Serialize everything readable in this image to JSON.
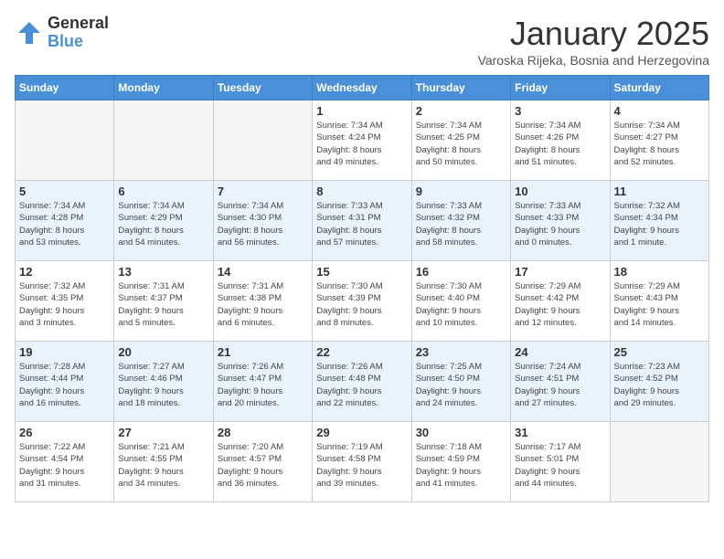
{
  "logo": {
    "general": "General",
    "blue": "Blue"
  },
  "header": {
    "month": "January 2025",
    "location": "Varoska Rijeka, Bosnia and Herzegovina"
  },
  "weekdays": [
    "Sunday",
    "Monday",
    "Tuesday",
    "Wednesday",
    "Thursday",
    "Friday",
    "Saturday"
  ],
  "weeks": [
    [
      {
        "day": "",
        "info": ""
      },
      {
        "day": "",
        "info": ""
      },
      {
        "day": "",
        "info": ""
      },
      {
        "day": "1",
        "info": "Sunrise: 7:34 AM\nSunset: 4:24 PM\nDaylight: 8 hours\nand 49 minutes."
      },
      {
        "day": "2",
        "info": "Sunrise: 7:34 AM\nSunset: 4:25 PM\nDaylight: 8 hours\nand 50 minutes."
      },
      {
        "day": "3",
        "info": "Sunrise: 7:34 AM\nSunset: 4:26 PM\nDaylight: 8 hours\nand 51 minutes."
      },
      {
        "day": "4",
        "info": "Sunrise: 7:34 AM\nSunset: 4:27 PM\nDaylight: 8 hours\nand 52 minutes."
      }
    ],
    [
      {
        "day": "5",
        "info": "Sunrise: 7:34 AM\nSunset: 4:28 PM\nDaylight: 8 hours\nand 53 minutes."
      },
      {
        "day": "6",
        "info": "Sunrise: 7:34 AM\nSunset: 4:29 PM\nDaylight: 8 hours\nand 54 minutes."
      },
      {
        "day": "7",
        "info": "Sunrise: 7:34 AM\nSunset: 4:30 PM\nDaylight: 8 hours\nand 56 minutes."
      },
      {
        "day": "8",
        "info": "Sunrise: 7:33 AM\nSunset: 4:31 PM\nDaylight: 8 hours\nand 57 minutes."
      },
      {
        "day": "9",
        "info": "Sunrise: 7:33 AM\nSunset: 4:32 PM\nDaylight: 8 hours\nand 58 minutes."
      },
      {
        "day": "10",
        "info": "Sunrise: 7:33 AM\nSunset: 4:33 PM\nDaylight: 9 hours\nand 0 minutes."
      },
      {
        "day": "11",
        "info": "Sunrise: 7:32 AM\nSunset: 4:34 PM\nDaylight: 9 hours\nand 1 minute."
      }
    ],
    [
      {
        "day": "12",
        "info": "Sunrise: 7:32 AM\nSunset: 4:35 PM\nDaylight: 9 hours\nand 3 minutes."
      },
      {
        "day": "13",
        "info": "Sunrise: 7:31 AM\nSunset: 4:37 PM\nDaylight: 9 hours\nand 5 minutes."
      },
      {
        "day": "14",
        "info": "Sunrise: 7:31 AM\nSunset: 4:38 PM\nDaylight: 9 hours\nand 6 minutes."
      },
      {
        "day": "15",
        "info": "Sunrise: 7:30 AM\nSunset: 4:39 PM\nDaylight: 9 hours\nand 8 minutes."
      },
      {
        "day": "16",
        "info": "Sunrise: 7:30 AM\nSunset: 4:40 PM\nDaylight: 9 hours\nand 10 minutes."
      },
      {
        "day": "17",
        "info": "Sunrise: 7:29 AM\nSunset: 4:42 PM\nDaylight: 9 hours\nand 12 minutes."
      },
      {
        "day": "18",
        "info": "Sunrise: 7:29 AM\nSunset: 4:43 PM\nDaylight: 9 hours\nand 14 minutes."
      }
    ],
    [
      {
        "day": "19",
        "info": "Sunrise: 7:28 AM\nSunset: 4:44 PM\nDaylight: 9 hours\nand 16 minutes."
      },
      {
        "day": "20",
        "info": "Sunrise: 7:27 AM\nSunset: 4:46 PM\nDaylight: 9 hours\nand 18 minutes."
      },
      {
        "day": "21",
        "info": "Sunrise: 7:26 AM\nSunset: 4:47 PM\nDaylight: 9 hours\nand 20 minutes."
      },
      {
        "day": "22",
        "info": "Sunrise: 7:26 AM\nSunset: 4:48 PM\nDaylight: 9 hours\nand 22 minutes."
      },
      {
        "day": "23",
        "info": "Sunrise: 7:25 AM\nSunset: 4:50 PM\nDaylight: 9 hours\nand 24 minutes."
      },
      {
        "day": "24",
        "info": "Sunrise: 7:24 AM\nSunset: 4:51 PM\nDaylight: 9 hours\nand 27 minutes."
      },
      {
        "day": "25",
        "info": "Sunrise: 7:23 AM\nSunset: 4:52 PM\nDaylight: 9 hours\nand 29 minutes."
      }
    ],
    [
      {
        "day": "26",
        "info": "Sunrise: 7:22 AM\nSunset: 4:54 PM\nDaylight: 9 hours\nand 31 minutes."
      },
      {
        "day": "27",
        "info": "Sunrise: 7:21 AM\nSunset: 4:55 PM\nDaylight: 9 hours\nand 34 minutes."
      },
      {
        "day": "28",
        "info": "Sunrise: 7:20 AM\nSunset: 4:57 PM\nDaylight: 9 hours\nand 36 minutes."
      },
      {
        "day": "29",
        "info": "Sunrise: 7:19 AM\nSunset: 4:58 PM\nDaylight: 9 hours\nand 39 minutes."
      },
      {
        "day": "30",
        "info": "Sunrise: 7:18 AM\nSunset: 4:59 PM\nDaylight: 9 hours\nand 41 minutes."
      },
      {
        "day": "31",
        "info": "Sunrise: 7:17 AM\nSunset: 5:01 PM\nDaylight: 9 hours\nand 44 minutes."
      },
      {
        "day": "",
        "info": ""
      }
    ]
  ]
}
